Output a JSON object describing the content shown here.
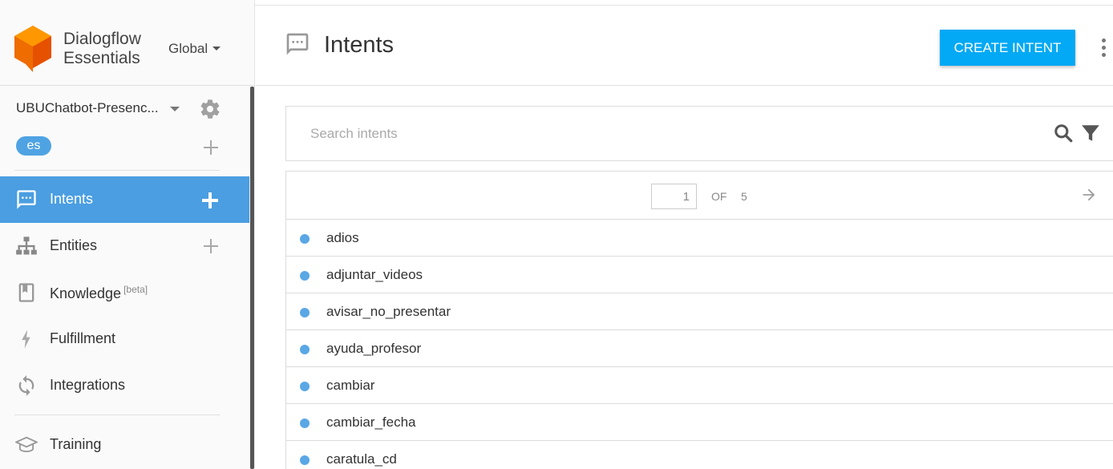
{
  "brand": {
    "name_line1": "Dialogflow",
    "name_line2": "Essentials",
    "region": "Global"
  },
  "agent": {
    "name": "UBUChatbot-Presenc...",
    "language": "es"
  },
  "nav": {
    "intents": "Intents",
    "entities": "Entities",
    "knowledge": "Knowledge",
    "knowledge_badge": "[beta]",
    "fulfillment": "Fulfillment",
    "integrations": "Integrations",
    "training": "Training"
  },
  "header": {
    "title": "Intents",
    "create_label": "CREATE INTENT"
  },
  "search": {
    "placeholder": "Search intents"
  },
  "pager": {
    "current": "1",
    "of_label": "OF",
    "total": "5"
  },
  "intents": [
    "adios",
    "adjuntar_videos",
    "avisar_no_presentar",
    "ayuda_profesor",
    "cambiar",
    "cambiar_fecha",
    "caratula_cd"
  ],
  "colors": {
    "accent": "#03a9f4",
    "nav_active": "#4a9ee1",
    "dot": "#5aa7e6",
    "logo": "#ef6c00"
  }
}
